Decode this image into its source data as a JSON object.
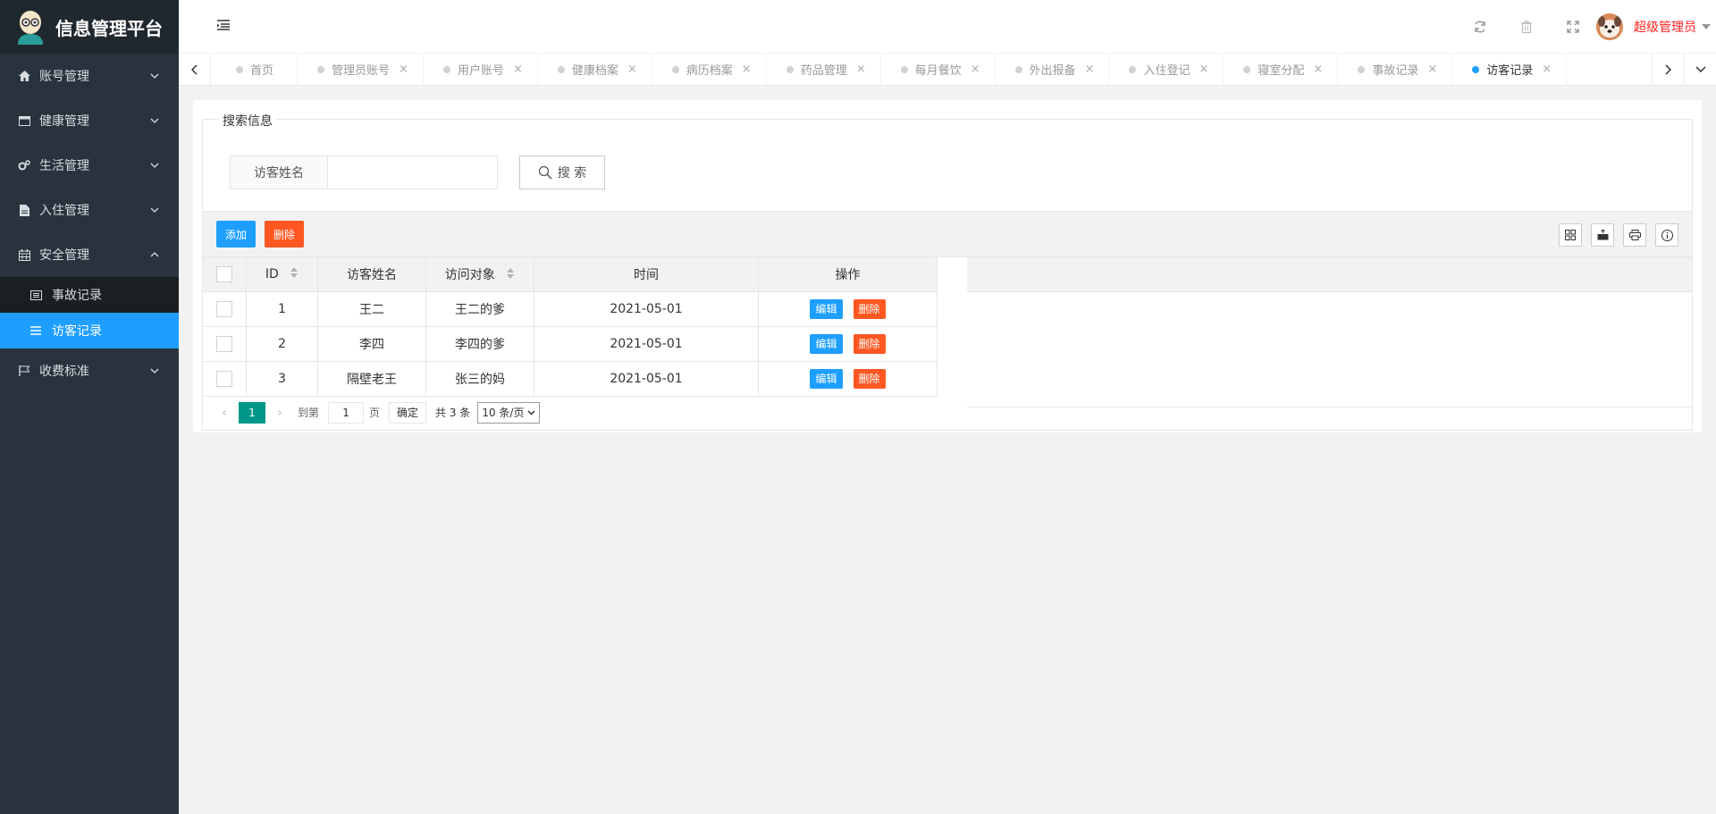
{
  "app": {
    "title": "信息管理平台"
  },
  "sidebar": {
    "items": [
      {
        "label": "账号管理",
        "icon": "home-icon"
      },
      {
        "label": "健康管理",
        "icon": "window-icon"
      },
      {
        "label": "生活管理",
        "icon": "gears-icon"
      },
      {
        "label": "入住管理",
        "icon": "document-icon"
      },
      {
        "label": "安全管理",
        "icon": "calendar-icon"
      },
      {
        "label": "收费标准",
        "icon": "flag-icon"
      }
    ],
    "subitems": [
      {
        "label": "事故记录",
        "icon": "list-alt-icon"
      },
      {
        "label": "访客记录",
        "icon": "bars-icon"
      }
    ]
  },
  "header": {
    "user_name": "超级管理员"
  },
  "tabs": [
    {
      "label": "首页",
      "closable": false
    },
    {
      "label": "管理员账号",
      "closable": true
    },
    {
      "label": "用户账号",
      "closable": true
    },
    {
      "label": "健康档案",
      "closable": true
    },
    {
      "label": "病历档案",
      "closable": true
    },
    {
      "label": "药品管理",
      "closable": true
    },
    {
      "label": "每月餐饮",
      "closable": true
    },
    {
      "label": "外出报备",
      "closable": true
    },
    {
      "label": "入住登记",
      "closable": true
    },
    {
      "label": "寝室分配",
      "closable": true
    },
    {
      "label": "事故记录",
      "closable": true
    },
    {
      "label": "访客记录",
      "closable": true,
      "active": true
    }
  ],
  "tab_close_glyph": "×",
  "search": {
    "legend": "搜索信息",
    "label": "访客姓名",
    "value": "",
    "button": "搜 索"
  },
  "toolbar": {
    "add_label": "添加",
    "delete_label": "删除"
  },
  "table": {
    "headers": [
      "ID",
      "访客姓名",
      "访问对象",
      "时间",
      "操作"
    ],
    "rows": [
      {
        "id": "1",
        "name": "王二",
        "target": "王二的爹",
        "time": "2021-05-01"
      },
      {
        "id": "2",
        "name": "李四",
        "target": "李四的爹",
        "time": "2021-05-01"
      },
      {
        "id": "3",
        "name": "隔壁老王",
        "target": "张三的妈",
        "time": "2021-05-01"
      }
    ],
    "edit_label": "编辑",
    "delete_label": "删除"
  },
  "pager": {
    "current": "1",
    "goto_prefix": "到第",
    "goto_value": "1",
    "goto_suffix": "页",
    "confirm": "确定",
    "total": "共 3 条",
    "page_size": "10 条/页"
  },
  "colors": {
    "accent": "#1e9fff",
    "danger": "#ff5722",
    "pager": "#009688",
    "sidebar": "#28333e"
  }
}
